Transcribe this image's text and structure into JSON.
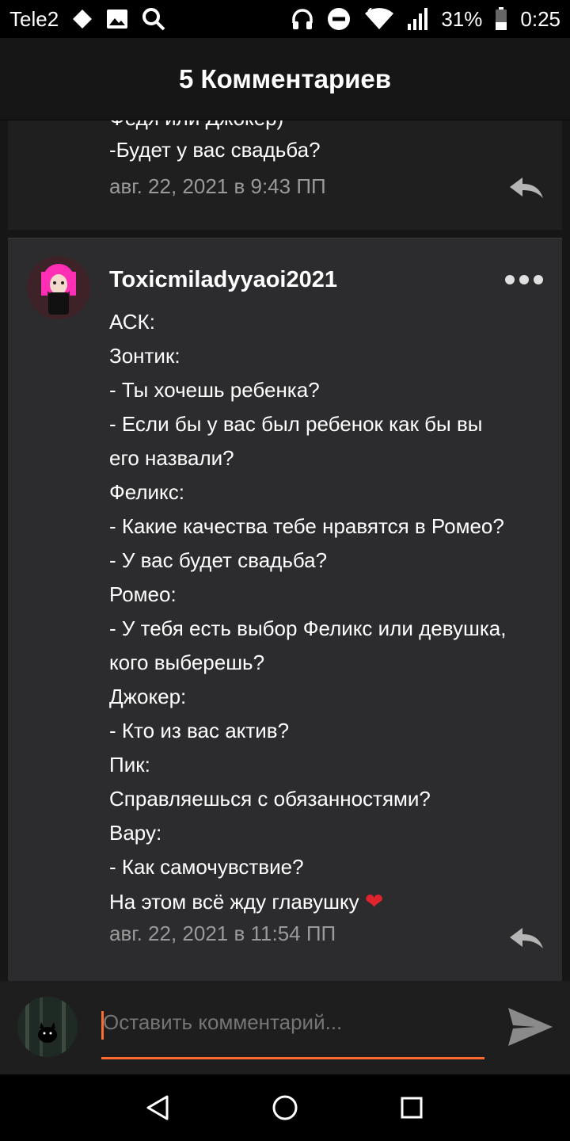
{
  "status_bar": {
    "carrier": "Tele2",
    "battery": "31%",
    "time": "0:25",
    "icons": [
      "signal-diamond-icon",
      "image-icon",
      "search-icon",
      "headphones-icon",
      "do-not-disturb-icon",
      "wifi-icon",
      "cell-signal-icon",
      "battery-icon"
    ]
  },
  "header": {
    "title": "5 Комментариев"
  },
  "previous_comment": {
    "lines": [
      "Федя или Джокер)",
      "-Будет у вас свадьба?"
    ],
    "timestamp": "авг. 22, 2021 в 9:43 ПП"
  },
  "comment": {
    "username": "Toxicmiladyyaoi2021",
    "lines": [
      "АСК:",
      "Зонтик:",
      "-  Ты хочешь ребенка?",
      "-  Если бы у вас был ребенок как бы вы",
      "его назвали?",
      "Феликс:",
      "- Какие качества тебе нравятся в Ромео?",
      "-  У вас будет свадьба?",
      "Ромео:",
      "- У тебя есть выбор Феликс или девушка,",
      "кого выберешь?",
      "Джокер:",
      "- Кто из вас актив?",
      "Пик:",
      "Справляешься с обязанностями?",
      "Вару:",
      "- Как самочувствие?",
      "На этом всё жду главушку"
    ],
    "heart": "❤",
    "timestamp": "авг. 22, 2021 в 11:54 ПП"
  },
  "input": {
    "placeholder": "Оставить комментарий..."
  },
  "colors": {
    "accent": "#ff6a2e",
    "background": "#161616",
    "comment_bg": "#2c2c2e",
    "muted_text": "#9a9a9a"
  }
}
